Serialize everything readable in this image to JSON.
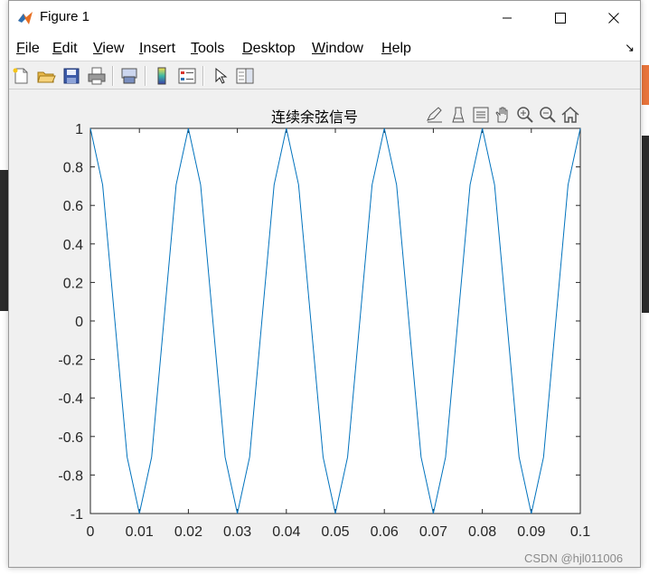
{
  "window": {
    "title": "Figure 1"
  },
  "menu": {
    "items": [
      {
        "label": "File",
        "mnemonic": "F",
        "rest": "ile"
      },
      {
        "label": "Edit",
        "mnemonic": "E",
        "rest": "dit"
      },
      {
        "label": "View",
        "mnemonic": "V",
        "rest": "iew"
      },
      {
        "label": "Insert",
        "mnemonic": "I",
        "rest": "nsert"
      },
      {
        "label": "Tools",
        "mnemonic": "T",
        "rest": "ools"
      },
      {
        "label": "Desktop",
        "mnemonic": "D",
        "rest": "esktop"
      },
      {
        "label": "Window",
        "mnemonic": "W",
        "rest": "indow"
      },
      {
        "label": "Help",
        "mnemonic": "H",
        "rest": "elp"
      }
    ]
  },
  "toolbar": {
    "icons": [
      "new-file-icon",
      "open-folder-icon",
      "save-icon",
      "print-icon",
      "link-plot-icon",
      "colorbar-icon",
      "legend-icon",
      "pointer-icon",
      "property-editor-icon"
    ]
  },
  "axes_toolbar": {
    "icons": [
      "brush-icon",
      "data-cursor-icon",
      "restore-view-icon",
      "pan-icon",
      "zoom-in-icon",
      "zoom-out-icon",
      "home-icon"
    ]
  },
  "chart_data": {
    "type": "line",
    "title": "连续余弦信号",
    "xlabel": "",
    "ylabel": "",
    "xlim": [
      0,
      0.1
    ],
    "ylim": [
      -1,
      1
    ],
    "xticks": [
      "0",
      "0.01",
      "0.02",
      "0.03",
      "0.04",
      "0.05",
      "0.06",
      "0.07",
      "0.08",
      "0.09",
      "0.1"
    ],
    "yticks": [
      "1",
      "0.8",
      "0.6",
      "0.4",
      "0.2",
      "0",
      "-0.2",
      "-0.4",
      "-0.6",
      "-0.8",
      "-1"
    ],
    "grid": false,
    "series": [
      {
        "color": "#0072bd",
        "x": [
          0,
          0.0025,
          0.005,
          0.0075,
          0.01,
          0.0125,
          0.015,
          0.0175,
          0.02,
          0.0225,
          0.025,
          0.0275,
          0.03,
          0.0325,
          0.035,
          0.0375,
          0.04,
          0.0425,
          0.045,
          0.0475,
          0.05,
          0.0525,
          0.055,
          0.0575,
          0.06,
          0.0625,
          0.065,
          0.0675,
          0.07,
          0.0725,
          0.075,
          0.0775,
          0.08,
          0.0825,
          0.085,
          0.0875,
          0.09,
          0.0925,
          0.095,
          0.0975,
          0.1
        ],
        "y": [
          1,
          0.707,
          0,
          -0.707,
          -1,
          -0.707,
          0,
          0.707,
          1,
          0.707,
          0,
          -0.707,
          -1,
          -0.707,
          0,
          0.707,
          1,
          0.707,
          0,
          -0.707,
          -1,
          -0.707,
          0,
          0.707,
          1,
          0.707,
          0,
          -0.707,
          -1,
          -0.707,
          0,
          0.707,
          1,
          0.707,
          0,
          -0.707,
          -1,
          -0.707,
          0,
          0.707,
          1
        ]
      }
    ]
  },
  "watermark": "CSDN @hjl011006"
}
